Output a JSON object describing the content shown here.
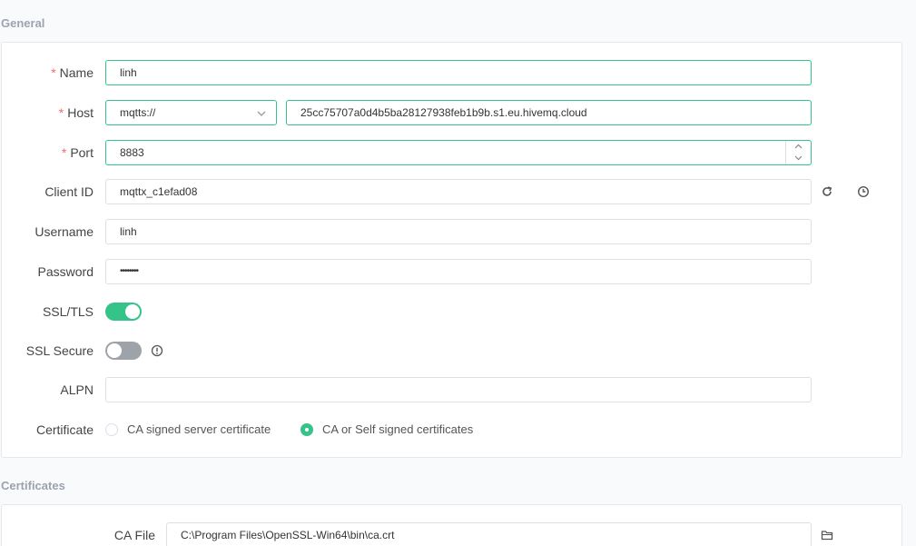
{
  "general": {
    "section_title": "General",
    "name": {
      "label": "Name",
      "required_mark": "*",
      "value": "linh"
    },
    "host": {
      "label": "Host",
      "required_mark": "*",
      "protocol": "mqtts://",
      "value": "25cc75707a0d4b5ba28127938feb1b9b.s1.eu.hivemq.cloud"
    },
    "port": {
      "label": "Port",
      "required_mark": "*",
      "value": "8883"
    },
    "client_id": {
      "label": "Client ID",
      "value": "mqttx_c1efad08"
    },
    "username": {
      "label": "Username",
      "value": "linh"
    },
    "password": {
      "label": "Password",
      "value": "••••••••"
    },
    "ssl_tls": {
      "label": "SSL/TLS",
      "enabled": true
    },
    "ssl_secure": {
      "label": "SSL Secure",
      "enabled": false
    },
    "alpn": {
      "label": "ALPN",
      "value": ""
    },
    "certificate": {
      "label": "Certificate",
      "options": [
        "CA signed server certificate",
        "CA or Self signed certificates"
      ],
      "selected": "CA or Self signed certificates"
    }
  },
  "certificates": {
    "section_title": "Certificates",
    "ca_file": {
      "label": "CA File",
      "value": "C:\\Program Files\\OpenSSL-Win64\\bin\\ca.crt"
    }
  },
  "colors": {
    "accent": "#34c388",
    "required": "#f56c6c",
    "toggle_off": "#9ea3a9"
  },
  "icons": {
    "host_protocol_dropdown": "chevron-down-icon",
    "port_increment": "chevron-up-icon",
    "port_decrement": "chevron-down-icon",
    "client_id_refresh": "refresh-icon",
    "client_id_timestamp": "clock-icon",
    "ssl_secure_info": "info-icon",
    "ca_file_browse": "folder-icon"
  }
}
